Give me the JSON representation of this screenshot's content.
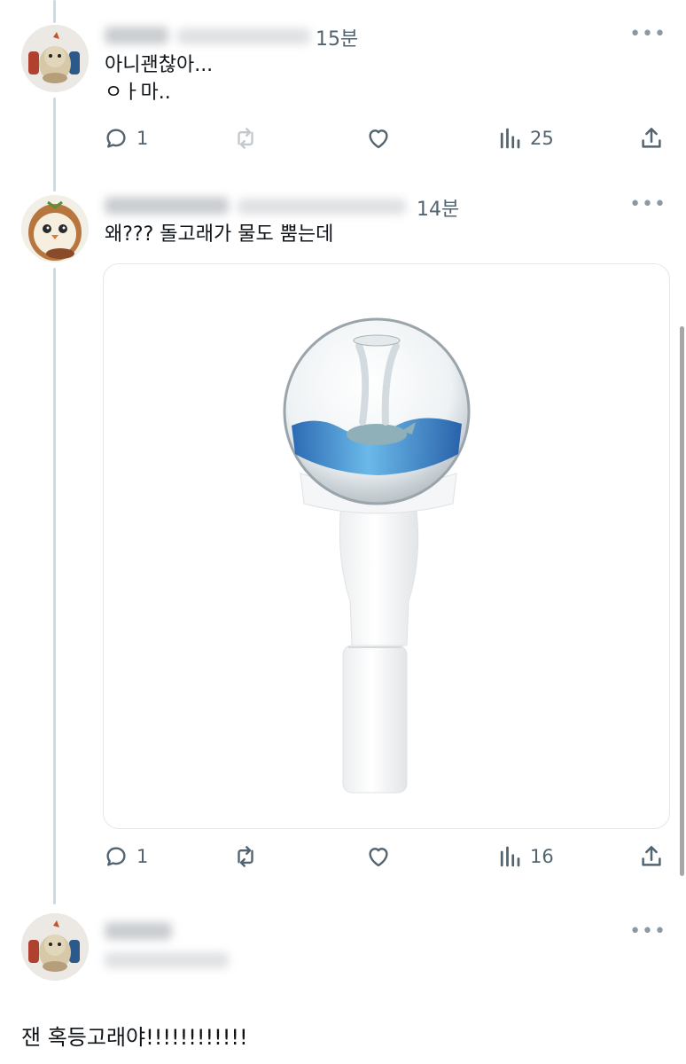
{
  "tweets": [
    {
      "time": "15분",
      "text": "아니괜찮아...\nㅇㅏ마..",
      "stats": {
        "replies": "1",
        "retweets": "",
        "views": "25"
      },
      "avatar_icon": "plush-doll-avatar"
    },
    {
      "time": "14분",
      "text": "왜??? 돌고래가 물도 뿜는데",
      "stats": {
        "replies": "1",
        "retweets": "",
        "views": "16"
      },
      "avatar_icon": "owl-avatar",
      "media": "whale-lightstick-image"
    },
    {
      "avatar_icon": "plush-doll-avatar"
    }
  ],
  "quote_text": "잰 혹등고래야!!!!!!!!!!!!",
  "colors": {
    "text": "#0f1419",
    "secondary": "#536471",
    "thread_line": "#cfd9de",
    "border": "#e3e7ea"
  }
}
